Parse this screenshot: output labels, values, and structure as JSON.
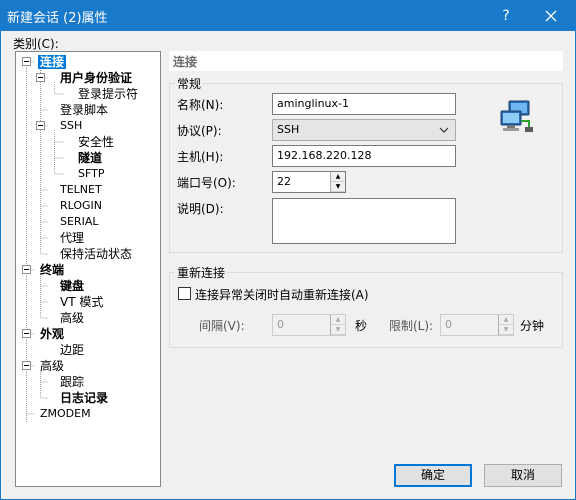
{
  "window": {
    "title": "新建会话 (2)属性",
    "help": "?",
    "accent": "#1979ca"
  },
  "category_label": "类别(C):",
  "tree": {
    "items": [
      {
        "label": "连接",
        "selected": true,
        "bold": true
      },
      {
        "label": "用户身份验证",
        "bold": true
      },
      {
        "label": "登录提示符"
      },
      {
        "label": "登录脚本"
      },
      {
        "label": "SSH"
      },
      {
        "label": "安全性"
      },
      {
        "label": "隧道",
        "bold": true
      },
      {
        "label": "SFTP"
      },
      {
        "label": "TELNET"
      },
      {
        "label": "RLOGIN"
      },
      {
        "label": "SERIAL"
      },
      {
        "label": "代理"
      },
      {
        "label": "保持活动状态"
      },
      {
        "label": "终端",
        "bold": true
      },
      {
        "label": "键盘",
        "bold": true
      },
      {
        "label": "VT 模式"
      },
      {
        "label": "高级"
      },
      {
        "label": "外观",
        "bold": true
      },
      {
        "label": "边距"
      },
      {
        "label": "高级"
      },
      {
        "label": "跟踪"
      },
      {
        "label": "日志记录",
        "bold": true
      },
      {
        "label": "ZMODEM"
      }
    ]
  },
  "panel": {
    "title": "连接",
    "general": {
      "title": "常规",
      "name_label": "名称(N):",
      "name_value": "aminglinux-1",
      "protocol_label": "协议(P):",
      "protocol_value": "SSH",
      "host_label": "主机(H):",
      "host_value": "192.168.220.128",
      "port_label": "端口号(O):",
      "port_value": "22",
      "desc_label": "说明(D):",
      "desc_value": ""
    },
    "reconnect": {
      "title": "重新连接",
      "checkbox_label": "连接异常关闭时自动重新连接(A)",
      "checked": false,
      "interval_label": "间隔(V):",
      "interval_value": "0",
      "seconds_unit": "秒",
      "limit_label": "限制(L):",
      "limit_value": "0",
      "minutes_unit": "分钟"
    }
  },
  "buttons": {
    "ok": "确定",
    "cancel": "取消"
  },
  "icons": {
    "window_close": "close-icon",
    "session": "network-computers-icon"
  }
}
